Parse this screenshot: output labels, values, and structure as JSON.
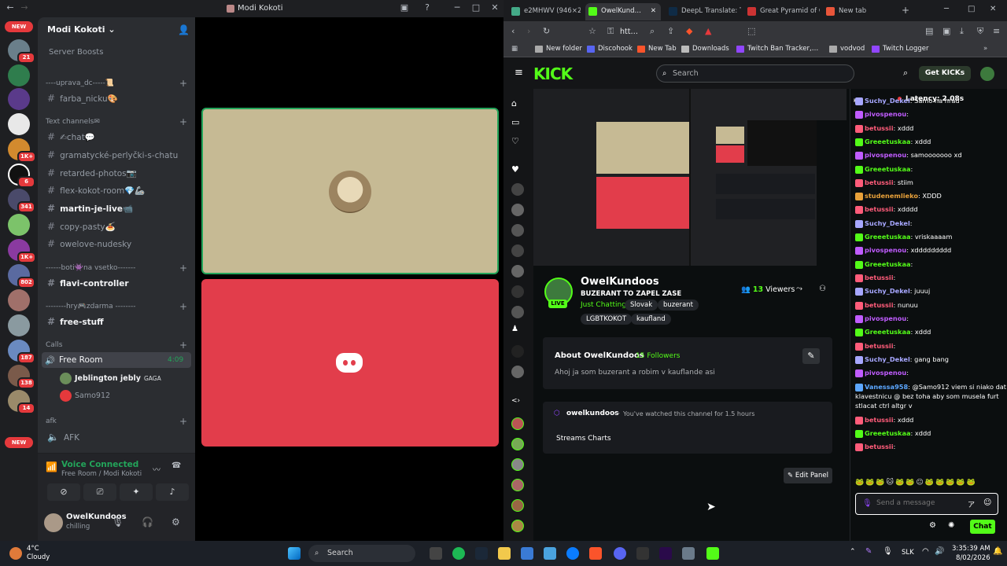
{
  "discord": {
    "window_title": "Modi Kokoti",
    "server_name": "Modi Kokoti",
    "server_boosts": "Server Boosts",
    "new_badge": "NEW",
    "server_badges": [
      "21",
      "1K+",
      "6",
      "341",
      "1K+",
      "802",
      "187",
      "138",
      "14"
    ],
    "categories": {
      "uprava": "----uprava_dc-----📜",
      "text": "Text channels✉",
      "boti": "------boti👾na vsetko-------",
      "hry": "--------hry🎮zdarma --------",
      "calls": "Calls",
      "afk": "afk"
    },
    "channels": {
      "farba": "farba_nicku🎨",
      "chat": "✍chat💬",
      "gram": "gramatycké-perlyčki-s-chatu",
      "retarded": "retarded-photos📷",
      "flex": "flex-kokot-room💎🦾",
      "martin": "martin-je-live📹",
      "copy": "copy-pasty🍝",
      "owelove": "owelove-nudesky",
      "flavi": "flavi-controller",
      "free": "free-stuff"
    },
    "voice_room": "Free Room",
    "voice_time": "4:09",
    "voice_users": [
      "Jeblington jebly",
      "Samo912"
    ],
    "voice_user_tag": "GAGA",
    "afk_channel": "AFK",
    "voice_connected": "Voice Connected",
    "voice_location": "Free Room / Modi Kokoti",
    "user_name": "OwelKundoos",
    "user_status": "chilling"
  },
  "browser": {
    "tabs": [
      "e2MHWV (946×20…",
      "OwelKund…",
      "DeepL Translate: T…",
      "Great Pyramid of C…",
      "New tab"
    ],
    "url": "htt…",
    "bookmarks": [
      "New folder",
      "Discohook",
      "New Tab",
      "Downloads",
      "Twitch Ban Tracker,…",
      "vodvod",
      "Twitch Logger"
    ]
  },
  "kick": {
    "search_placeholder": "Search",
    "get_kicks": "Get KICKs",
    "channel_name": "OwelKundoos",
    "stream_title": "BUZERANT TO ZAPEL ZASE",
    "category": "Just Chatting",
    "tags": [
      "Slovak",
      "buzerant",
      "LGBTKOKOT",
      "kaufland"
    ],
    "viewers_count": "13",
    "viewers_label": "Viewers",
    "live": "LIVE",
    "about_title": "About OwelKundoos",
    "followers": "15 Followers",
    "bio": "Ahoj ja som buzerant a robim v kauflande asi",
    "panel_user": "owelkundoos",
    "panel_watched": "You've watched this channel for 1.5 hours",
    "streams_charts": "Streams Charts",
    "edit_panel": "Edit Panel",
    "latency": "Latency: 2.08s",
    "chat_placeholder": "Send a message",
    "chat_button": "Chat",
    "messages": [
      {
        "user": "Suchy_Dekel",
        "text": "Samo na hrad",
        "color": "#a7a7ff"
      },
      {
        "user": "pivospenou",
        "text": "",
        "color": "#c05cff"
      },
      {
        "user": "betussii",
        "text": "xddd",
        "color": "#ff5c7a"
      },
      {
        "user": "Greeetuskaa",
        "text": "xddd",
        "color": "#53fc18"
      },
      {
        "user": "pivospenou",
        "text": "samooooooo xd",
        "color": "#c05cff"
      },
      {
        "user": "Greeetuskaa",
        "text": "",
        "color": "#53fc18"
      },
      {
        "user": "betussii",
        "text": "stiim",
        "color": "#ff5c7a"
      },
      {
        "user": "studenemlieko",
        "text": "XDDD",
        "color": "#e8a13a"
      },
      {
        "user": "betussii",
        "text": "xdddd",
        "color": "#ff5c7a"
      },
      {
        "user": "Suchy_Dekel",
        "text": "",
        "color": "#a7a7ff"
      },
      {
        "user": "Greeetuskaa",
        "text": "vriskaaaam",
        "color": "#53fc18"
      },
      {
        "user": "pivospenou",
        "text": "xddddddddd",
        "color": "#c05cff"
      },
      {
        "user": "Greeetuskaa",
        "text": "",
        "color": "#53fc18"
      },
      {
        "user": "betussii",
        "text": "",
        "color": "#ff5c7a"
      },
      {
        "user": "Suchy_Dekel",
        "text": "juuuj",
        "color": "#a7a7ff"
      },
      {
        "user": "betussii",
        "text": "nunuu",
        "color": "#ff5c7a"
      },
      {
        "user": "pivospenou",
        "text": "",
        "color": "#c05cff"
      },
      {
        "user": "Greeetuskaa",
        "text": "xddd",
        "color": "#53fc18"
      },
      {
        "user": "betussii",
        "text": "",
        "color": "#ff5c7a"
      },
      {
        "user": "Suchy_Dekel",
        "text": "gang bang",
        "color": "#a7a7ff"
      },
      {
        "user": "pivospenou",
        "text": "",
        "color": "#c05cff"
      },
      {
        "user": "Vanessa958",
        "text": "@Samo912 viem si niako dat na",
        "color": "#5ca7ff"
      },
      {
        "user": "",
        "text": "klavestnicu @ bez toha aby som musela furt",
        "color": "#fff"
      },
      {
        "user": "",
        "text": "stlacat ctrl altgr v",
        "color": "#fff"
      },
      {
        "user": "betussii",
        "text": "xddd",
        "color": "#ff5c7a"
      },
      {
        "user": "Greeetuskaa",
        "text": "xddd",
        "color": "#53fc18"
      },
      {
        "user": "betussii",
        "text": "",
        "color": "#ff5c7a"
      }
    ]
  },
  "taskbar": {
    "temperature": "4°C",
    "weather": "Cloudy",
    "search": "Search",
    "language": "SLK",
    "time": "3:35:39 AM",
    "date": "8/02/2026"
  }
}
